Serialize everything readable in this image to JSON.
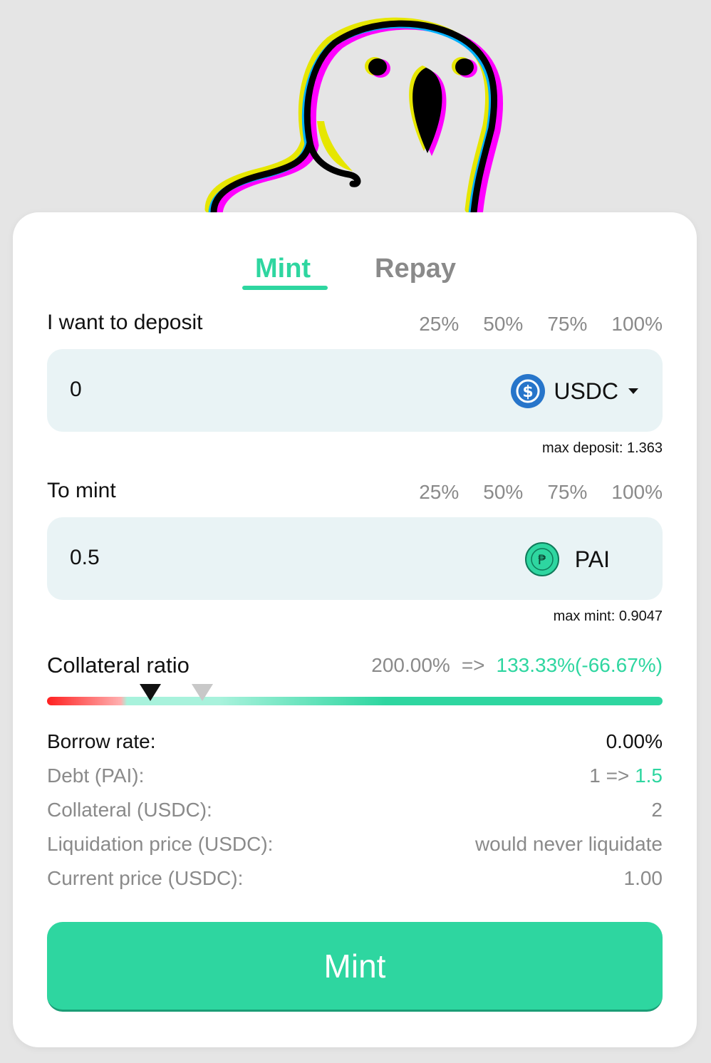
{
  "tabs": {
    "mint": "Mint",
    "repay": "Repay",
    "active": "mint"
  },
  "deposit": {
    "label": "I want to deposit",
    "percentages": [
      "25%",
      "50%",
      "75%",
      "100%"
    ],
    "value": "0",
    "token": "USDC",
    "token_icon": "usdc-dollar-icon",
    "max_note": "max deposit: 1.363"
  },
  "mint_section": {
    "label": "To mint",
    "percentages": [
      "25%",
      "50%",
      "75%",
      "100%"
    ],
    "value": "0.5",
    "token": "PAI",
    "token_icon": "pai-peso-icon",
    "max_note": "max mint: 0.9047"
  },
  "collateral_ratio": {
    "label": "Collateral ratio",
    "current": "200.00%",
    "arrow": "=>",
    "new": "133.33%(-66.67%)"
  },
  "info": {
    "borrow_rate": {
      "label": "Borrow rate:",
      "value": "0.00%"
    },
    "debt": {
      "label": "Debt (PAI):",
      "from": "1 =>",
      "to": "1.5"
    },
    "collateral": {
      "label": "Collateral (USDC):",
      "value": "2"
    },
    "liquidation_price": {
      "label": "Liquidation price (USDC):",
      "value": "would never liquidate"
    },
    "current_price": {
      "label": "Current price (USDC):",
      "value": "1.00"
    }
  },
  "action_button": "Mint",
  "colors": {
    "accent": "#2ed6a0",
    "input_bg": "#e9f3f5",
    "muted": "#8a8a8a",
    "usdc": "#2775ca"
  }
}
